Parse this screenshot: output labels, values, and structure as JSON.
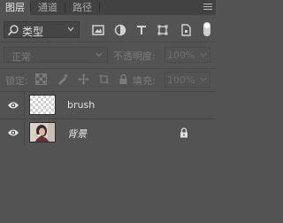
{
  "tabs": [
    {
      "label": "图层",
      "active": true
    },
    {
      "label": "通道",
      "active": false
    },
    {
      "label": "路径",
      "active": false
    }
  ],
  "filter": {
    "kind_label": "类型",
    "icons": [
      "image-filter-icon",
      "adjustment-filter-icon",
      "type-filter-icon",
      "shape-filter-icon",
      "smart-object-filter-icon"
    ],
    "toggle_icon": "filter-toggle-icon"
  },
  "blend": {
    "mode": "正常",
    "opacity_label": "不透明度:",
    "opacity_value": "100%"
  },
  "lock": {
    "label": "锁定:",
    "icons": [
      "lock-transparent-pixels-icon",
      "lock-image-pixels-icon",
      "lock-position-icon",
      "lock-artboard-icon",
      "lock-all-icon"
    ],
    "fill_label": "填充:",
    "fill_value": "100%"
  },
  "layers": [
    {
      "name": "brush",
      "visible": true,
      "locked": false,
      "thumbnail": "transparent"
    },
    {
      "name": "背景",
      "visible": true,
      "locked": true,
      "thumbnail": "photo"
    }
  ],
  "colors": {
    "panel_bg": "#535353",
    "tabbar_bg": "#424242",
    "text": "#e2e2e2",
    "disabled_text": "#7c7c7c"
  }
}
